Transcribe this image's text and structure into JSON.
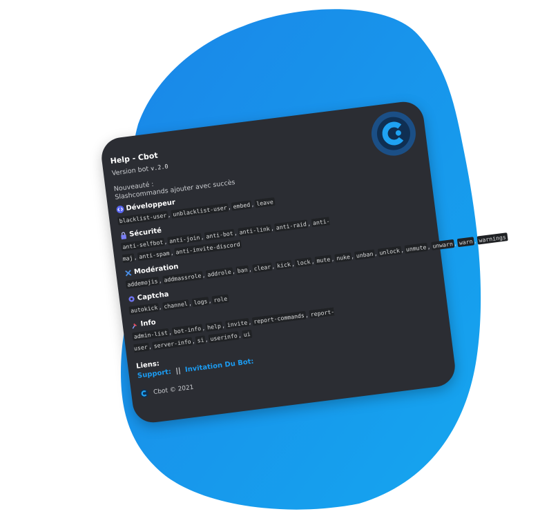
{
  "embed": {
    "title": "Help - Cbot",
    "version_prefix": "Version bot",
    "version_value": "v.2.0",
    "news_label": "Nouveauté :",
    "news_text": "Slashcommands ajouter avec succès"
  },
  "sections": [
    {
      "icon": "code-icon",
      "title": "Développeur",
      "commands": [
        "blacklist-user",
        "unblacklist-user",
        "embed",
        "leave"
      ]
    },
    {
      "icon": "lock-icon",
      "title": "Sécurité",
      "commands": [
        "anti-selfbot",
        "anti-join",
        "anti-bot",
        "anti-link",
        "anti-raid",
        "anti-maj",
        "anti-spam",
        "anti-invite-discord"
      ]
    },
    {
      "icon": "tools-icon",
      "title": "Modération",
      "commands": [
        "addemojis",
        "addmassrole",
        "addrole",
        "ban",
        "clear",
        "kick",
        "lock",
        "mute",
        "nuke",
        "unban",
        "unlock",
        "unmute",
        "unwarn",
        "warn",
        "warnings"
      ]
    },
    {
      "icon": "gear-icon",
      "title": "Captcha",
      "commands": [
        "autokick",
        "channel",
        "logs",
        "role"
      ]
    },
    {
      "icon": "pin-icon",
      "title": "Info",
      "commands": [
        "admin-list",
        "bot-info",
        "help",
        "invite",
        "report-commands",
        "report-user",
        "server-info",
        "si",
        "userinfo",
        "ui"
      ]
    }
  ],
  "links": {
    "title": "Liens:",
    "support": "Support:",
    "separator": "||",
    "invite": "Invitation Du Bot:"
  },
  "footer": {
    "text": "Cbot © 2021"
  },
  "colors": {
    "blob": "#1e90e6",
    "card": "#2b2d33",
    "accent": "#1c9bf0",
    "logo_bg": "#1b4f86"
  }
}
